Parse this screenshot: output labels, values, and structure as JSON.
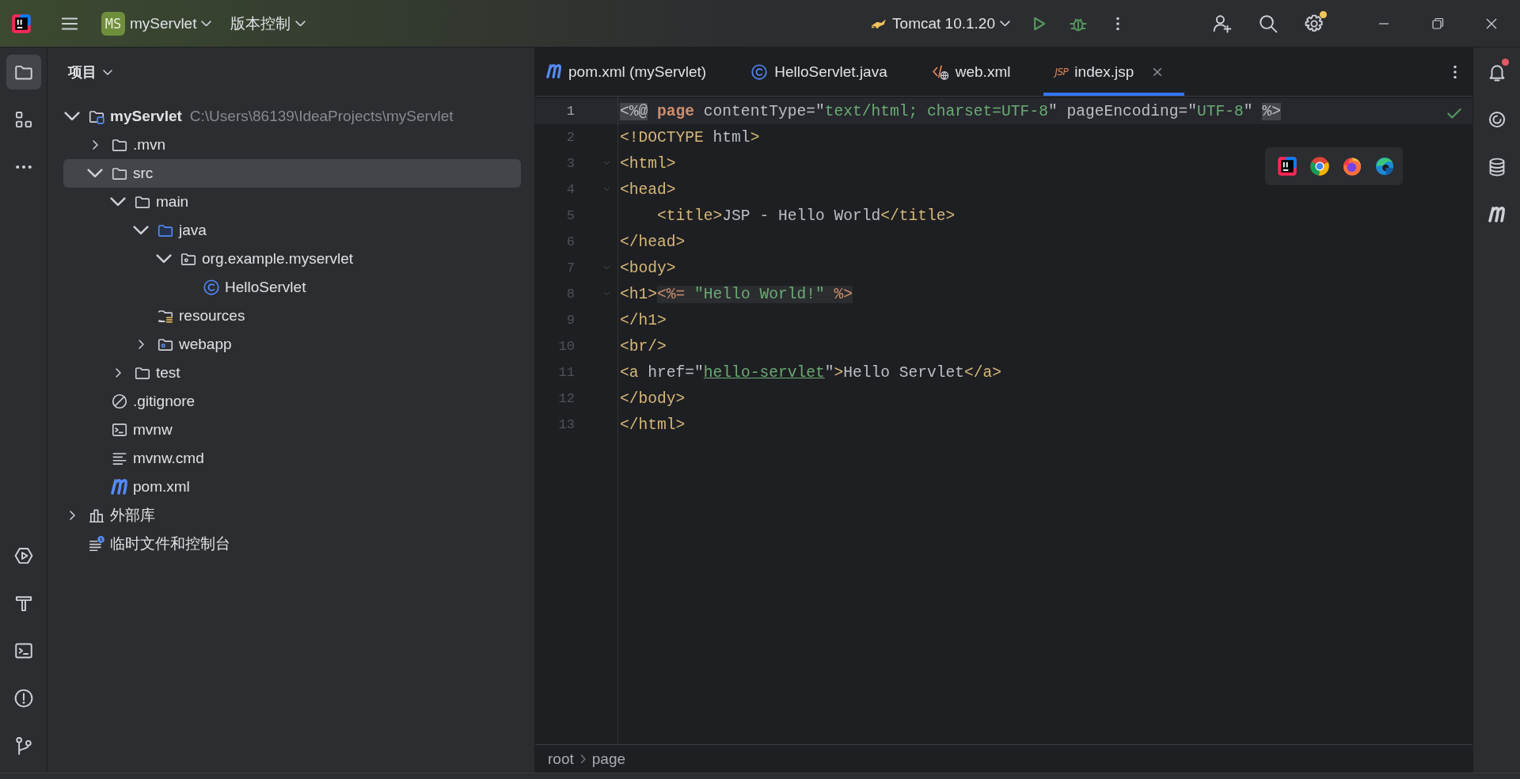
{
  "title_bar": {
    "project_badge": "MS",
    "project": "myServlet",
    "vcs": "版本控制",
    "run_config": "Tomcat 10.1.20",
    "settings_badge": true
  },
  "left_strip": {
    "top": [
      {
        "kind": "project",
        "selected": true
      },
      {
        "kind": "structure",
        "selected": false
      },
      {
        "kind": "more",
        "selected": false
      }
    ],
    "bottom": [
      {
        "kind": "services",
        "selected": false
      },
      {
        "kind": "build",
        "selected": false
      },
      {
        "kind": "terminal",
        "selected": false
      },
      {
        "kind": "problems",
        "selected": false
      },
      {
        "kind": "git",
        "selected": false
      }
    ]
  },
  "project_panel": {
    "title": "项目",
    "tree": [
      {
        "label": "myServlet",
        "path": "C:\\Users\\86139\\IdeaProjects\\myServlet",
        "kind": "module",
        "expanded": true,
        "selected": false,
        "children": [
          {
            "label": ".mvn",
            "kind": "folder",
            "expanded": false,
            "selected": false
          },
          {
            "label": "src",
            "kind": "folder",
            "expanded": true,
            "selected": true,
            "children": [
              {
                "label": "main",
                "kind": "folder",
                "expanded": true,
                "selected": false,
                "children": [
                  {
                    "label": "java",
                    "kind": "source-folder",
                    "expanded": true,
                    "selected": false,
                    "children": [
                      {
                        "label": "org.example.myservlet",
                        "kind": "package",
                        "expanded": true,
                        "selected": false,
                        "children": [
                          {
                            "label": "HelloServlet",
                            "kind": "class",
                            "selected": false
                          }
                        ]
                      }
                    ]
                  },
                  {
                    "label": "resources",
                    "kind": "resources",
                    "selected": false
                  },
                  {
                    "label": "webapp",
                    "kind": "web-folder",
                    "expanded": false,
                    "selected": false
                  }
                ]
              },
              {
                "label": "test",
                "kind": "folder",
                "expanded": false,
                "selected": false
              }
            ]
          },
          {
            "label": ".gitignore",
            "kind": "ignore",
            "selected": false
          },
          {
            "label": "mvnw",
            "kind": "script",
            "selected": false
          },
          {
            "label": "mvnw.cmd",
            "kind": "text-file",
            "selected": false
          },
          {
            "label": "pom.xml",
            "kind": "maven",
            "selected": false
          }
        ]
      },
      {
        "label": "外部库",
        "kind": "library",
        "expanded": false,
        "selected": false
      },
      {
        "label": "临时文件和控制台",
        "kind": "scratch",
        "selected": false
      }
    ]
  },
  "editor": {
    "tabs": [
      {
        "label": "pom.xml (myServlet)",
        "kind": "maven",
        "selected": false,
        "closable": false
      },
      {
        "label": "HelloServlet.java",
        "kind": "class",
        "selected": false,
        "closable": false
      },
      {
        "label": "web.xml",
        "kind": "xml",
        "selected": false,
        "closable": false
      },
      {
        "label": "index.jsp",
        "kind": "jsp",
        "icon_label": "JSP",
        "selected": true,
        "closable": true
      }
    ],
    "no_problems": true,
    "lines": [
      {
        "number": "1",
        "current": true,
        "fold": false,
        "tokens": [
          {
            "text": "<%@",
            "kind": "delim"
          },
          {
            "text": " page",
            "kind": "keyword"
          },
          {
            "text": " contentType=\"",
            "kind": "attr"
          },
          {
            "text": "text/html; charset=UTF-8",
            "kind": "string"
          },
          {
            "text": "\" pageEncoding=\"",
            "kind": "attr"
          },
          {
            "text": "UTF-8",
            "kind": "string"
          },
          {
            "text": "\" ",
            "kind": "attr"
          },
          {
            "text": "%>",
            "kind": "delim"
          }
        ]
      },
      {
        "number": "2",
        "current": false,
        "fold": false,
        "tokens": [
          {
            "text": "<!DOCTYPE",
            "kind": "tag"
          },
          {
            "text": " html",
            "kind": "attr"
          },
          {
            "text": ">",
            "kind": "tag"
          }
        ]
      },
      {
        "number": "3",
        "current": false,
        "fold": true,
        "tokens": [
          {
            "text": "<html>",
            "kind": "tag"
          }
        ]
      },
      {
        "number": "4",
        "current": false,
        "fold": true,
        "tokens": [
          {
            "text": "<head>",
            "kind": "tag"
          }
        ]
      },
      {
        "number": "5",
        "current": false,
        "fold": false,
        "tokens": [
          {
            "text": "    <title>",
            "kind": "tag"
          },
          {
            "text": "JSP - Hello World",
            "kind": "text"
          },
          {
            "text": "</title>",
            "kind": "tag"
          }
        ]
      },
      {
        "number": "6",
        "current": false,
        "fold": false,
        "tokens": [
          {
            "text": "</head>",
            "kind": "tag"
          }
        ]
      },
      {
        "number": "7",
        "current": false,
        "fold": true,
        "tokens": [
          {
            "text": "<body>",
            "kind": "tag"
          }
        ]
      },
      {
        "number": "8",
        "current": false,
        "fold": true,
        "tokens": [
          {
            "text": "<h1>",
            "kind": "tag"
          },
          {
            "text": "<%=",
            "kind": "jsp"
          },
          {
            "text": " \"Hello World!\" ",
            "kind": "jsp-string"
          },
          {
            "text": "%>",
            "kind": "jsp"
          }
        ]
      },
      {
        "number": "9",
        "current": false,
        "fold": false,
        "tokens": [
          {
            "text": "</h1>",
            "kind": "tag"
          }
        ]
      },
      {
        "number": "10",
        "current": false,
        "fold": false,
        "tokens": [
          {
            "text": "<br/>",
            "kind": "tag"
          }
        ]
      },
      {
        "number": "11",
        "current": false,
        "fold": false,
        "tokens": [
          {
            "text": "<a",
            "kind": "tag"
          },
          {
            "text": " href=\"",
            "kind": "attr"
          },
          {
            "text": "hello-servlet",
            "kind": "link"
          },
          {
            "text": "\"",
            "kind": "attr"
          },
          {
            "text": ">",
            "kind": "tag"
          },
          {
            "text": "Hello Servlet",
            "kind": "text"
          },
          {
            "text": "</a>",
            "kind": "tag"
          }
        ]
      },
      {
        "number": "12",
        "current": false,
        "fold": false,
        "tokens": [
          {
            "text": "</body>",
            "kind": "tag"
          }
        ]
      },
      {
        "number": "13",
        "current": false,
        "fold": false,
        "tokens": [
          {
            "text": "</html>",
            "kind": "tag"
          }
        ]
      }
    ],
    "breadcrumbs": [
      "root",
      "page"
    ]
  },
  "right_strip": {
    "notifications_badge": true
  }
}
